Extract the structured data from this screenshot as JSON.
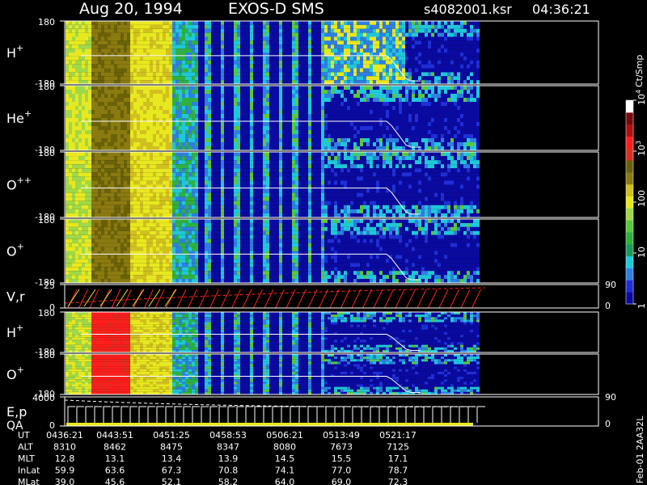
{
  "header": {
    "date": "Aug 20, 1994",
    "instrument": "EXOS-D SMS",
    "file": "s4082001.ksr",
    "time": "04:36:21"
  },
  "colorbar": {
    "unit_label": "Ct/Smp",
    "tick_labels": [
      "1",
      "10",
      "100",
      "10",
      "10"
    ],
    "tick_superscripts": [
      "",
      "",
      "",
      "3",
      "4"
    ],
    "scale": "log",
    "range": [
      1,
      10000
    ],
    "colors": [
      "#0a0a9e",
      "#1f2fd6",
      "#2e7fe0",
      "#1fc8d8",
      "#1a9a5a",
      "#2fb040",
      "#5ac83a",
      "#9fd84a",
      "#e8e820",
      "#d0c020",
      "#8a7a10",
      "#6a6208",
      "#d83020",
      "#ff1e1e",
      "#b01010",
      "#7a0a0a",
      "#ffffff"
    ]
  },
  "chart_data": [
    {
      "type": "heatmap",
      "ylabel": "H",
      "ylabel_sup": "+",
      "y_ticks": [
        "180",
        "-180"
      ],
      "ylim": [
        -180,
        180
      ]
    },
    {
      "type": "heatmap",
      "ylabel": "He",
      "ylabel_sup": "+",
      "y_ticks": [
        "180",
        "-180"
      ],
      "ylim": [
        -180,
        180
      ]
    },
    {
      "type": "heatmap",
      "ylabel": "O",
      "ylabel_sup": "++",
      "y_ticks": [
        "180",
        "-180"
      ],
      "ylim": [
        -180,
        180
      ]
    },
    {
      "type": "heatmap",
      "ylabel": "O",
      "ylabel_sup": "+",
      "y_ticks": [
        "180",
        "-180"
      ],
      "ylim": [
        -180,
        180
      ]
    },
    {
      "type": "line",
      "ylabel": "V,r",
      "y_ticks": [
        "25",
        "0"
      ],
      "right_ticks": [
        "90",
        "0"
      ]
    },
    {
      "type": "heatmap",
      "ylabel": "H",
      "ylabel_sup": "+",
      "y_ticks": [
        "180",
        "-180"
      ],
      "ylim": [
        -180,
        180
      ]
    },
    {
      "type": "heatmap",
      "ylabel": "O",
      "ylabel_sup": "+",
      "y_ticks": [
        "180",
        "-180"
      ],
      "ylim": [
        -180,
        180
      ]
    },
    {
      "type": "line",
      "ylabel": "E,p",
      "ylabel2": "QA",
      "y_ticks": [
        "4000",
        "0"
      ],
      "right_ticks": [
        "90",
        "0"
      ]
    }
  ],
  "ephemeris": {
    "rows": [
      {
        "label": "UT",
        "values": [
          "0436:21",
          "0443:51",
          "0451:25",
          "0458:53",
          "0506:21",
          "0513:49",
          "0521:17"
        ]
      },
      {
        "label": "ALT",
        "values": [
          "8310",
          "8462",
          "8475",
          "8347",
          "8080",
          "7673",
          "7125"
        ]
      },
      {
        "label": "MLT",
        "values": [
          "12.8",
          "13.1",
          "13.4",
          "13.9",
          "14.5",
          "15.5",
          "17.1"
        ]
      },
      {
        "label": "InLat",
        "values": [
          "59.9",
          "63.6",
          "67.3",
          "70.8",
          "74.1",
          "77.0",
          "78.7"
        ]
      },
      {
        "label": "MLat",
        "values": [
          "39.0",
          "45.6",
          "52.1",
          "58.2",
          "64.0",
          "69.0",
          "72.3"
        ]
      }
    ]
  },
  "footer": {
    "side_label": "Feb-01 2AA32L"
  }
}
